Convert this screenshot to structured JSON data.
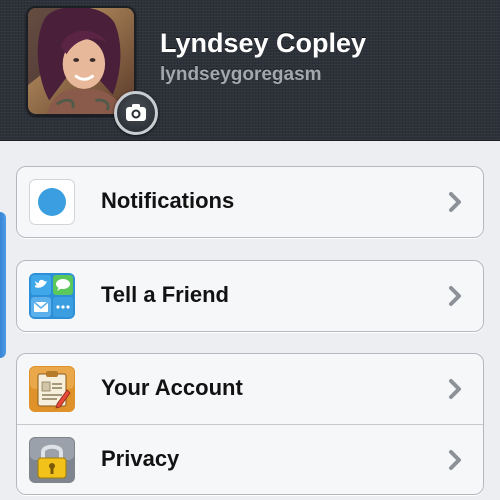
{
  "profile": {
    "name": "Lyndsey Copley",
    "handle": "lyndseygoregasm",
    "avatar_icon": "profile-photo",
    "camera_icon": "camera-icon"
  },
  "menu": {
    "group1": [
      {
        "label": "Notifications",
        "icon": "notifications-dot-icon",
        "color": "#3a9ee0"
      }
    ],
    "group2": [
      {
        "label": "Tell a Friend",
        "icon": "share-icon"
      }
    ],
    "group3": [
      {
        "label": "Your Account",
        "icon": "account-clipboard-icon"
      },
      {
        "label": "Privacy",
        "icon": "padlock-icon"
      }
    ]
  },
  "colors": {
    "header_bg": "#2d323a",
    "page_bg": "#eceef1",
    "accent_blue": "#3a9ee0"
  }
}
